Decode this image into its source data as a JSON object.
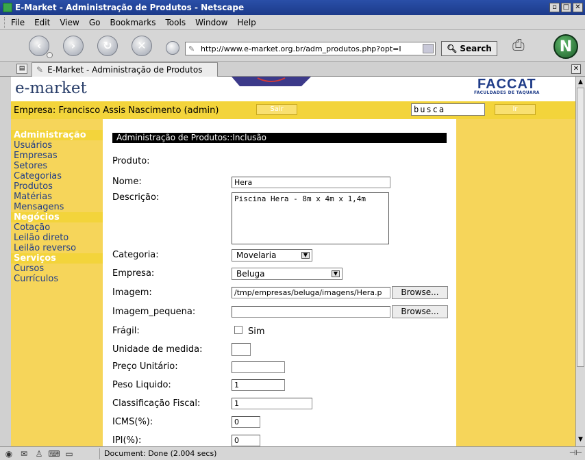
{
  "window": {
    "title": "E-Market - Administração de Produtos - Netscape",
    "controls": [
      "▫",
      "□",
      "✕"
    ]
  },
  "menu": [
    "File",
    "Edit",
    "View",
    "Go",
    "Bookmarks",
    "Tools",
    "Window",
    "Help"
  ],
  "toolbar": {
    "url": "http://www.e-market.org.br/adm_produtos.php?opt=I",
    "search_label": "Search"
  },
  "tab": {
    "label": "E-Market - Administração de Produtos"
  },
  "site": {
    "logo": "e-market",
    "partner_logo": "FACCAT",
    "partner_subtitle": "FACULDADES DE TAQUARA",
    "empresa": "Empresa: Francisco Assis Nascimento (admin)",
    "sair": "Sair",
    "busca": "busca",
    "ir": "Ir"
  },
  "sidebar": {
    "sections": [
      {
        "title": "Administração",
        "links": [
          "Usuários",
          "Empresas",
          "Setores",
          "Categorias",
          "Produtos",
          "Matérias",
          "Mensagens"
        ]
      },
      {
        "title": "Negócios",
        "links": [
          "Cotação",
          "Leilão direto",
          "Leilão reverso"
        ]
      },
      {
        "title": "Serviços",
        "links": [
          "Cursos",
          "Currículos"
        ]
      }
    ]
  },
  "form": {
    "heading": "Administração de Produtos::Inclusão",
    "produto_label": "Produto:",
    "nome_label": "Nome:",
    "nome_value": "Hera",
    "descricao_label": "Descrição:",
    "descricao_value": "Piscina Hera - 8m x 4m x 1,4m",
    "categoria_label": "Categoria:",
    "categoria_value": "Movelaria",
    "empresa_label": "Empresa:",
    "empresa_value": "Beluga",
    "imagem_label": "Imagem:",
    "imagem_value": "/tmp/empresas/beluga/imagens/Hera.p",
    "browse_label": "Browse...",
    "imagem_pequena_label": "Imagem_pequena:",
    "imagem_pequena_value": "",
    "fragil_label": "Frágil:",
    "fragil_option": "Sim",
    "unidade_label": "Unidade de medida:",
    "unidade_value": "",
    "preco_label": "Preço Unitário:",
    "preco_value": "",
    "peso_label": "Peso Liquido:",
    "peso_value": "1",
    "classificacao_label": "Classificação Fiscal:",
    "classificacao_value": "1",
    "icms_label": "ICMS(%):",
    "icms_value": "0",
    "ipi_label": "IPI(%):",
    "ipi_value": "0"
  },
  "status": {
    "text": "Document: Done (2.004 secs)"
  },
  "colors": {
    "accent_yellow": "#f3d43b",
    "page_yellow": "#f6d55a",
    "link_blue": "#1f3c88",
    "title_blue": "#1c3a8a"
  }
}
